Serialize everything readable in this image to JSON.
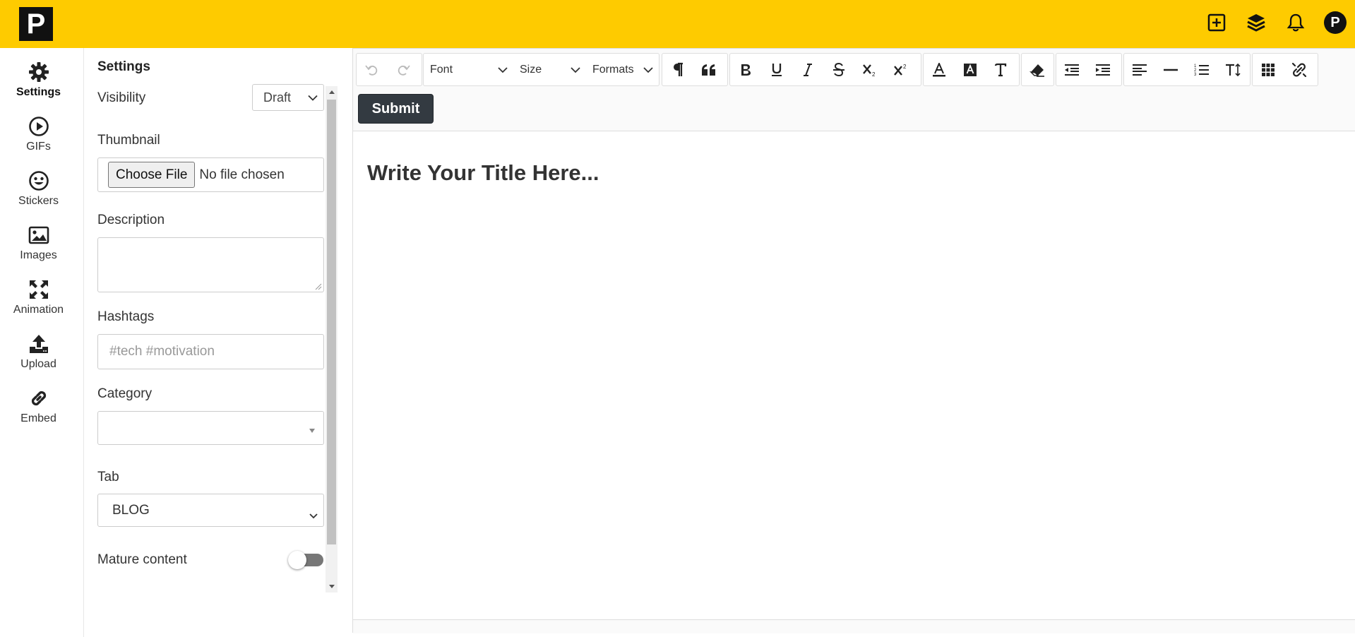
{
  "logo": {
    "letter": "P"
  },
  "topbar": {
    "icons": [
      "plus-square-icon",
      "layers-icon",
      "bell-icon"
    ],
    "avatar_letter": "P",
    "colors": {
      "brand": "#fecb00"
    }
  },
  "sidebar": {
    "items": [
      {
        "label": "Settings",
        "icon": "gear-icon",
        "active": true
      },
      {
        "label": "GIFs",
        "icon": "play-circle-icon"
      },
      {
        "label": "Stickers",
        "icon": "smiley-icon"
      },
      {
        "label": "Images",
        "icon": "image-icon"
      },
      {
        "label": "Animation",
        "icon": "expand-arrows-icon"
      },
      {
        "label": "Upload",
        "icon": "upload-icon"
      },
      {
        "label": "Embed",
        "icon": "link-icon"
      }
    ]
  },
  "settings": {
    "title": "Settings",
    "visibility": {
      "label": "Visibility",
      "value": "Draft"
    },
    "thumbnail": {
      "label": "Thumbnail",
      "button": "Choose File",
      "status": "No file chosen"
    },
    "description": {
      "label": "Description",
      "value": ""
    },
    "hashtags": {
      "label": "Hashtags",
      "placeholder": "#tech #motivation"
    },
    "category": {
      "label": "Category",
      "value": ""
    },
    "tab": {
      "label": "Tab",
      "value": "BLOG"
    },
    "mature": {
      "label": "Mature content",
      "on": false
    }
  },
  "editor": {
    "toolbar": {
      "font": "Font",
      "size": "Size",
      "formats": "Formats"
    },
    "submit_label": "Submit",
    "title_placeholder": "Write Your Title Here..."
  }
}
